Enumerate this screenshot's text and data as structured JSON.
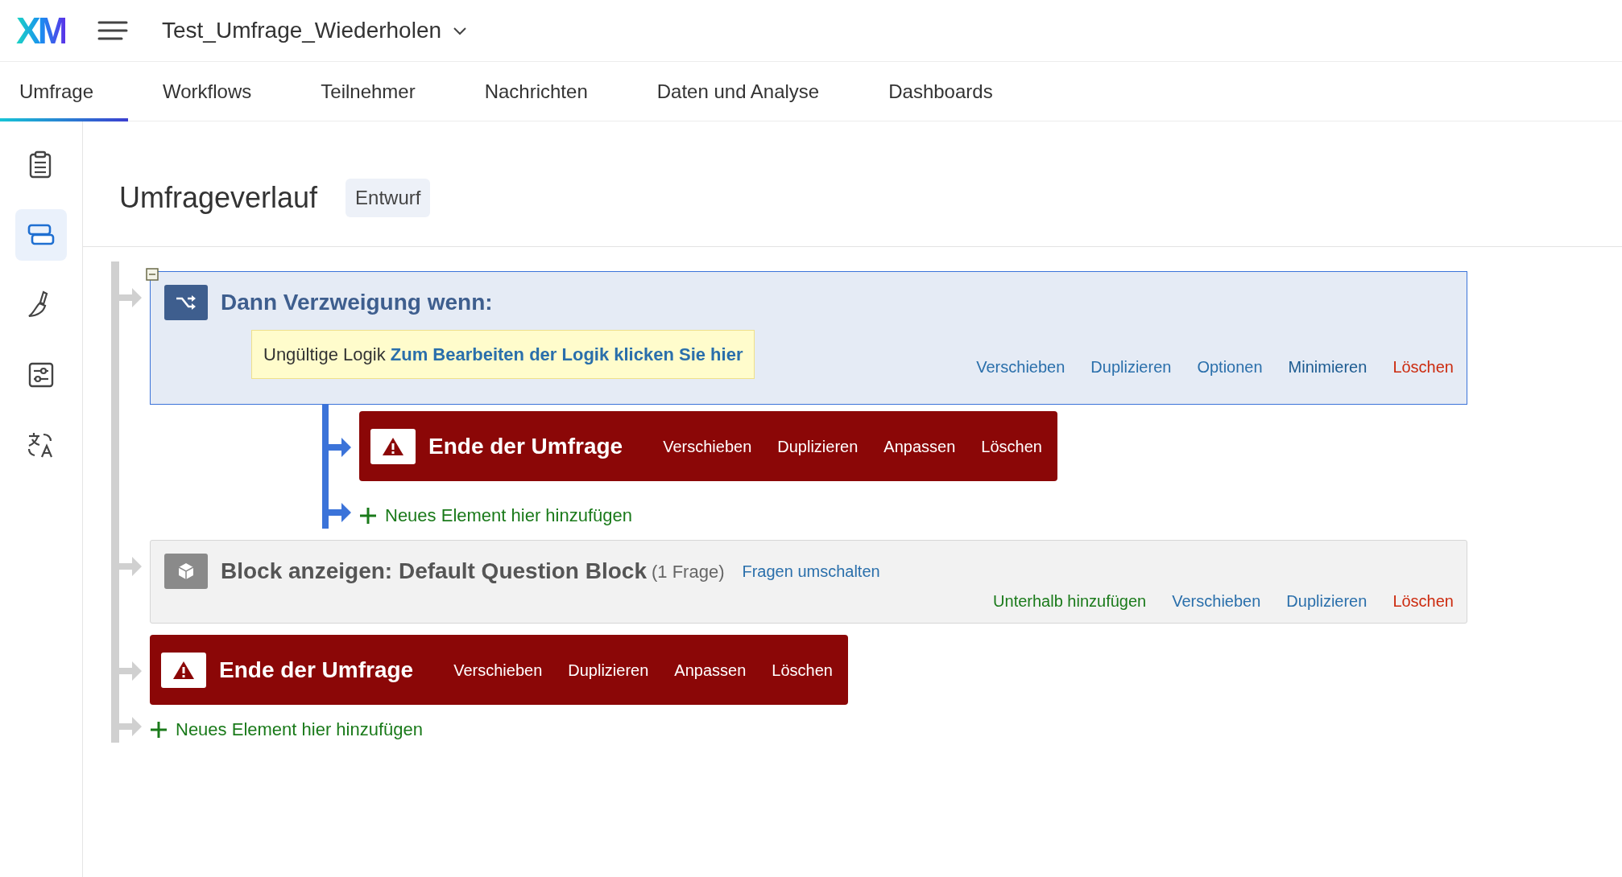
{
  "app": {
    "logo": "XM",
    "survey_title": "Test_Umfrage_Wiederholen"
  },
  "tabs": [
    {
      "label": "Umfrage",
      "selected": true
    },
    {
      "label": "Workflows",
      "selected": false
    },
    {
      "label": "Teilnehmer",
      "selected": false
    },
    {
      "label": "Nachrichten",
      "selected": false
    },
    {
      "label": "Daten und Analyse",
      "selected": false
    },
    {
      "label": "Dashboards",
      "selected": false
    }
  ],
  "sidebar": {
    "items": [
      {
        "selected": false
      },
      {
        "selected": true
      },
      {
        "selected": false
      },
      {
        "selected": false
      },
      {
        "selected": false
      }
    ]
  },
  "page": {
    "title": "Umfrageverlauf",
    "status_badge": "Entwurf"
  },
  "flow": [
    {
      "kind": "branch",
      "expanded": true,
      "title": "Dann Verzweigung wenn:",
      "warning": {
        "label": "Ungültige Logik",
        "link": "Zum Bearbeiten der Logik klicken Sie hier"
      },
      "actions": [
        {
          "label": "Verschieben",
          "kind": "default"
        },
        {
          "label": "Duplizieren",
          "kind": "default"
        },
        {
          "label": "Optionen",
          "kind": "default"
        },
        {
          "label": "Minimieren",
          "kind": "strong"
        },
        {
          "label": "Löschen",
          "kind": "danger"
        }
      ],
      "children": [
        {
          "kind": "end",
          "title": "Ende der Umfrage",
          "actions": [
            {
              "label": "Verschieben"
            },
            {
              "label": "Duplizieren"
            },
            {
              "label": "Anpassen"
            },
            {
              "label": "Löschen"
            }
          ]
        },
        {
          "kind": "add",
          "label": "Neues Element hier hinzufügen"
        }
      ]
    },
    {
      "kind": "block",
      "title": "Block anzeigen: Default Question Block",
      "count": "(1 Frage)",
      "toggle": "Fragen umschalten",
      "actions": [
        {
          "label": "Unterhalb hinzufügen",
          "kind": "add"
        },
        {
          "label": "Verschieben",
          "kind": "default"
        },
        {
          "label": "Duplizieren",
          "kind": "default"
        },
        {
          "label": "Löschen",
          "kind": "danger"
        }
      ]
    },
    {
      "kind": "end",
      "title": "Ende der Umfrage",
      "actions": [
        {
          "label": "Verschieben"
        },
        {
          "label": "Duplizieren"
        },
        {
          "label": "Anpassen"
        },
        {
          "label": "Löschen"
        }
      ]
    },
    {
      "kind": "add",
      "label": "Neues Element hier hinzufügen"
    }
  ]
}
